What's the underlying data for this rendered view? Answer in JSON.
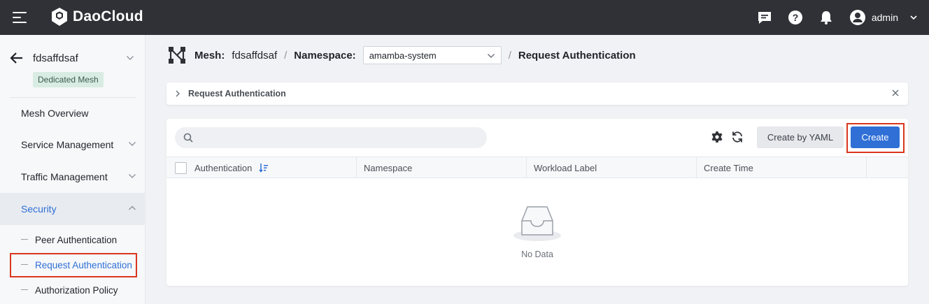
{
  "topbar": {
    "brand": "DaoCloud",
    "user": "admin",
    "icons": [
      "menu-icon",
      "message-icon",
      "help-icon",
      "bell-icon",
      "user-avatar-icon",
      "chevron-down-icon"
    ]
  },
  "sidebar": {
    "mesh_name": "fdsaffdsaf",
    "mesh_badge": "Dedicated Mesh",
    "items": [
      {
        "label": "Mesh Overview"
      },
      {
        "label": "Service Management"
      },
      {
        "label": "Traffic Management"
      },
      {
        "label": "Security"
      }
    ],
    "sub_items": [
      {
        "label": "Peer Authentication"
      },
      {
        "label": "Request Authentication"
      },
      {
        "label": "Authorization Policy"
      }
    ]
  },
  "breadcrumb": {
    "mesh_label": "Mesh:",
    "mesh_value": "fdsaffdsaf",
    "namespace_label": "Namespace:",
    "namespace_value": "amamba-system",
    "page": "Request Authentication"
  },
  "notice": {
    "title": "Request Authentication"
  },
  "toolbar": {
    "search_placeholder": "",
    "create_yaml_label": "Create by YAML",
    "create_label": "Create"
  },
  "table": {
    "columns": [
      "Authentication",
      "Namespace",
      "Workload Label",
      "Create Time"
    ],
    "empty_text": "No Data"
  },
  "colors": {
    "topbar": "#2f3136",
    "primary": "#2f6fd6",
    "highlight": "#d9371e",
    "badge_bg": "#d8ece4"
  }
}
